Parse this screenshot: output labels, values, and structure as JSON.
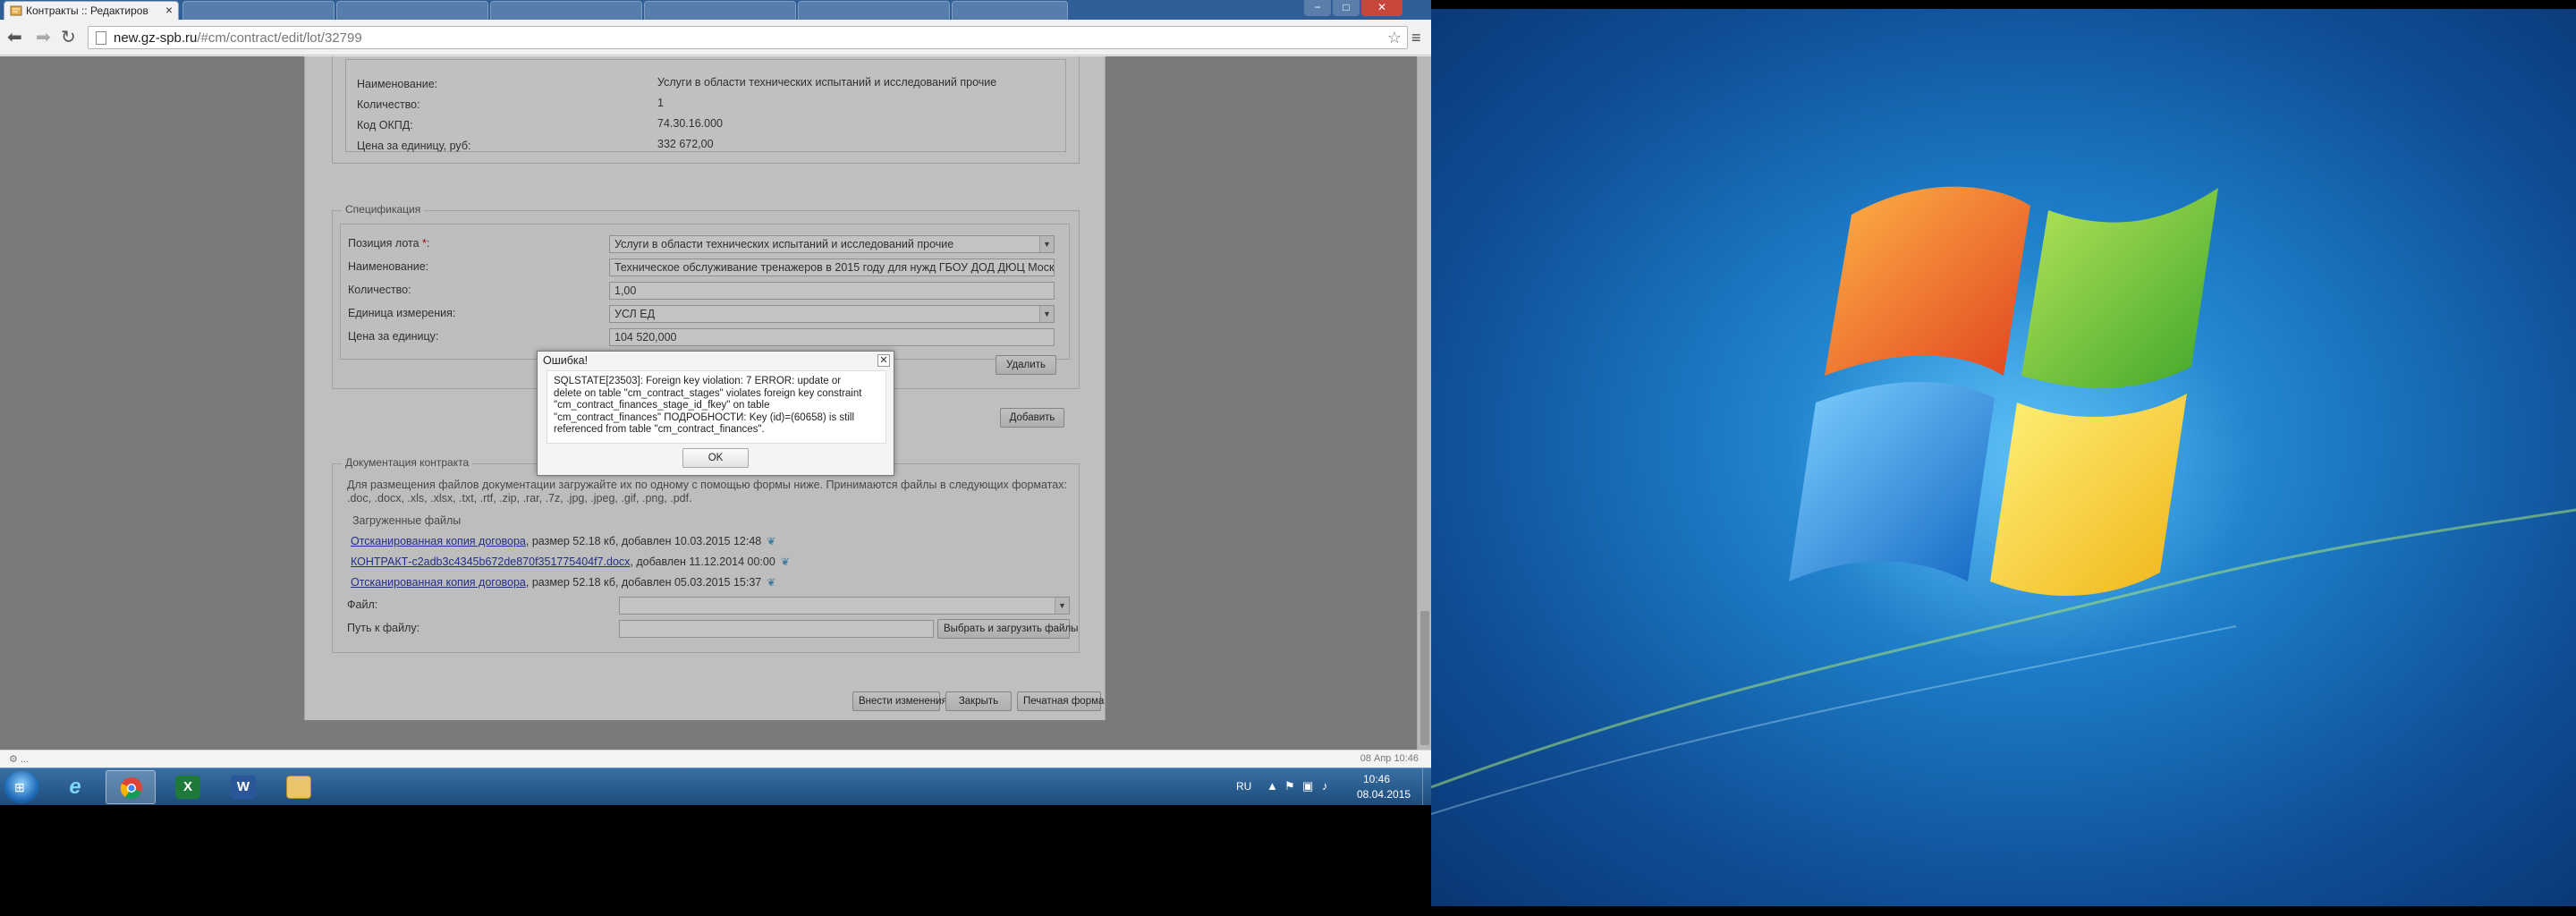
{
  "browser": {
    "tab_title": "Контракты :: Редактиров",
    "tab_close": "×",
    "url_host": "new.gz-spb.ru",
    "url_path": "/#cm/contract/edit/lot/32799",
    "window_controls": {
      "minimize": "−",
      "maximize": "□",
      "close": "✕"
    }
  },
  "lot_summary": {
    "rows": [
      {
        "label": "Наименование:",
        "value": "Услуги в области технических испытаний и исследований прочие"
      },
      {
        "label": "Количество:",
        "value": "1"
      },
      {
        "label": "Код ОКПД:",
        "value": "74.30.16.000"
      },
      {
        "label": "Цена за единицу, руб:",
        "value": "332 672,00"
      }
    ]
  },
  "specification": {
    "legend": "Спецификация",
    "lot_position_label": "Позиция лота",
    "lot_position_required": " *",
    "lot_position_colon": ":",
    "lot_position_value": "Услуги в области технических испытаний и исследований прочие",
    "name_label": "Наименование:",
    "name_value": "Техническое обслуживание тренажеров в 2015 году для нужд ГБОУ ДОД ДЮЦ Моско",
    "quantity_label": "Количество:",
    "quantity_value": "1,00",
    "unit_label": "Единица измерения:",
    "unit_value": "УСЛ ЕД",
    "price_label": "Цена за единицу:",
    "price_value": "104 520,000",
    "delete_button": "Удалить",
    "add_button": "Добавить"
  },
  "documents": {
    "legend": "Документация контракта",
    "hint_line1": "Для размещения файлов документации загружайте их по одному с помощью формы ниже. Принимаются файлы в следующих форматах:",
    "hint_line2": ".doc, .docx, .xls, .xlsx, .txt, .rtf, .zip, .rar, .7z, .jpg, .jpeg, .gif, .png, .pdf.",
    "uploaded_label": "Загруженные файлы",
    "files": [
      {
        "name": "Отсканированная копия договора",
        "info": ", размер 52.18 кб, добавлен 10.03.2015 12:48"
      },
      {
        "name": "КОНТРАКТ-c2adb3c4345b672de870f351775404f7.docx",
        "info": ", добавлен 11.12.2014 00:00"
      },
      {
        "name": "Отсканированная копия договора",
        "info": ", размер 52.18 кб, добавлен 05.03.2015 15:37"
      }
    ],
    "file_label": "Файл:",
    "path_label": "Путь к файлу:",
    "upload_button": "Выбрать и загрузить файлы"
  },
  "footer_buttons": {
    "save": "Внести изменения",
    "close": "Закрыть",
    "print": "Печатная форма"
  },
  "dialog": {
    "title": "Ошибка!",
    "close": "✕",
    "message_lines": [
      "SQLSTATE[23503]: Foreign key violation: 7 ERROR: update or",
      "delete on table \"cm_contract_stages\" violates foreign key constraint",
      "\"cm_contract_finances_stage_id_fkey\" on table",
      "\"cm_contract_finances\" ПОДРОБНОСТИ: Key (id)=(60658) is still",
      "referenced from table \"cm_contract_finances\"."
    ],
    "ok": "OK"
  },
  "status": {
    "left": "⚙ ...",
    "right": "08 Апр 10:46"
  },
  "taskbar": {
    "language": "RU",
    "time": "10:46",
    "date": "08.04.2015",
    "apps": [
      "internet-explorer",
      "chrome",
      "excel",
      "word",
      "explorer"
    ]
  },
  "colors": {
    "desktop_blue": "#1d7cc7",
    "taskbar": "#2a5d90",
    "link": "#2233aa"
  }
}
